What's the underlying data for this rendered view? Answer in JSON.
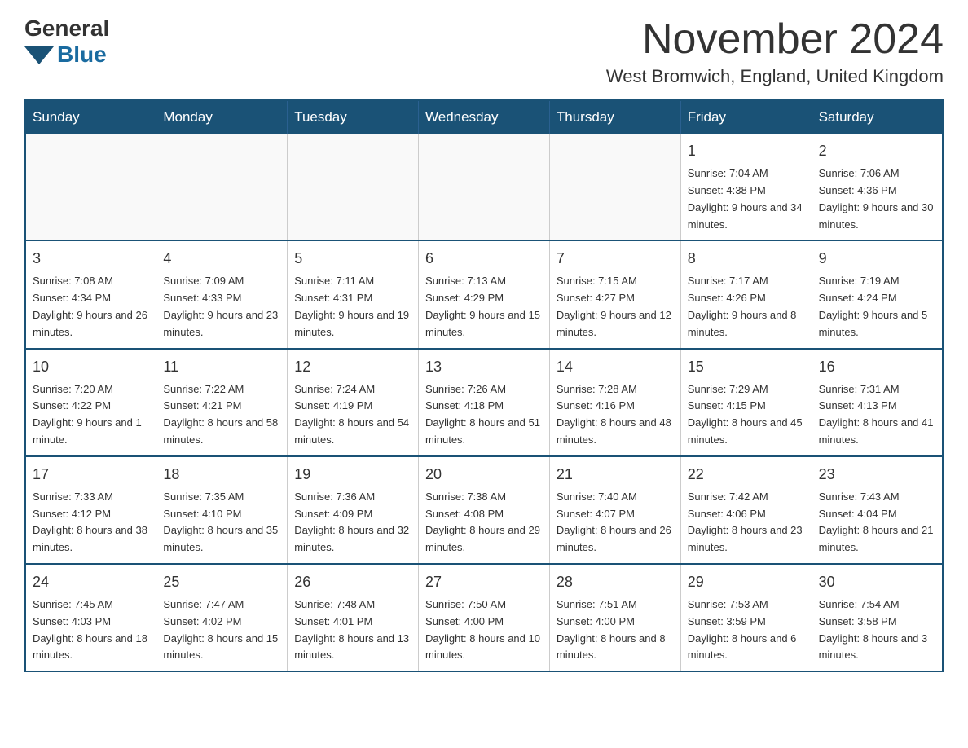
{
  "logo": {
    "general": "General",
    "blue": "Blue"
  },
  "title": "November 2024",
  "location": "West Bromwich, England, United Kingdom",
  "weekdays": [
    "Sunday",
    "Monday",
    "Tuesday",
    "Wednesday",
    "Thursday",
    "Friday",
    "Saturday"
  ],
  "weeks": [
    [
      {
        "day": "",
        "info": ""
      },
      {
        "day": "",
        "info": ""
      },
      {
        "day": "",
        "info": ""
      },
      {
        "day": "",
        "info": ""
      },
      {
        "day": "",
        "info": ""
      },
      {
        "day": "1",
        "info": "Sunrise: 7:04 AM\nSunset: 4:38 PM\nDaylight: 9 hours and 34 minutes."
      },
      {
        "day": "2",
        "info": "Sunrise: 7:06 AM\nSunset: 4:36 PM\nDaylight: 9 hours and 30 minutes."
      }
    ],
    [
      {
        "day": "3",
        "info": "Sunrise: 7:08 AM\nSunset: 4:34 PM\nDaylight: 9 hours and 26 minutes."
      },
      {
        "day": "4",
        "info": "Sunrise: 7:09 AM\nSunset: 4:33 PM\nDaylight: 9 hours and 23 minutes."
      },
      {
        "day": "5",
        "info": "Sunrise: 7:11 AM\nSunset: 4:31 PM\nDaylight: 9 hours and 19 minutes."
      },
      {
        "day": "6",
        "info": "Sunrise: 7:13 AM\nSunset: 4:29 PM\nDaylight: 9 hours and 15 minutes."
      },
      {
        "day": "7",
        "info": "Sunrise: 7:15 AM\nSunset: 4:27 PM\nDaylight: 9 hours and 12 minutes."
      },
      {
        "day": "8",
        "info": "Sunrise: 7:17 AM\nSunset: 4:26 PM\nDaylight: 9 hours and 8 minutes."
      },
      {
        "day": "9",
        "info": "Sunrise: 7:19 AM\nSunset: 4:24 PM\nDaylight: 9 hours and 5 minutes."
      }
    ],
    [
      {
        "day": "10",
        "info": "Sunrise: 7:20 AM\nSunset: 4:22 PM\nDaylight: 9 hours and 1 minute."
      },
      {
        "day": "11",
        "info": "Sunrise: 7:22 AM\nSunset: 4:21 PM\nDaylight: 8 hours and 58 minutes."
      },
      {
        "day": "12",
        "info": "Sunrise: 7:24 AM\nSunset: 4:19 PM\nDaylight: 8 hours and 54 minutes."
      },
      {
        "day": "13",
        "info": "Sunrise: 7:26 AM\nSunset: 4:18 PM\nDaylight: 8 hours and 51 minutes."
      },
      {
        "day": "14",
        "info": "Sunrise: 7:28 AM\nSunset: 4:16 PM\nDaylight: 8 hours and 48 minutes."
      },
      {
        "day": "15",
        "info": "Sunrise: 7:29 AM\nSunset: 4:15 PM\nDaylight: 8 hours and 45 minutes."
      },
      {
        "day": "16",
        "info": "Sunrise: 7:31 AM\nSunset: 4:13 PM\nDaylight: 8 hours and 41 minutes."
      }
    ],
    [
      {
        "day": "17",
        "info": "Sunrise: 7:33 AM\nSunset: 4:12 PM\nDaylight: 8 hours and 38 minutes."
      },
      {
        "day": "18",
        "info": "Sunrise: 7:35 AM\nSunset: 4:10 PM\nDaylight: 8 hours and 35 minutes."
      },
      {
        "day": "19",
        "info": "Sunrise: 7:36 AM\nSunset: 4:09 PM\nDaylight: 8 hours and 32 minutes."
      },
      {
        "day": "20",
        "info": "Sunrise: 7:38 AM\nSunset: 4:08 PM\nDaylight: 8 hours and 29 minutes."
      },
      {
        "day": "21",
        "info": "Sunrise: 7:40 AM\nSunset: 4:07 PM\nDaylight: 8 hours and 26 minutes."
      },
      {
        "day": "22",
        "info": "Sunrise: 7:42 AM\nSunset: 4:06 PM\nDaylight: 8 hours and 23 minutes."
      },
      {
        "day": "23",
        "info": "Sunrise: 7:43 AM\nSunset: 4:04 PM\nDaylight: 8 hours and 21 minutes."
      }
    ],
    [
      {
        "day": "24",
        "info": "Sunrise: 7:45 AM\nSunset: 4:03 PM\nDaylight: 8 hours and 18 minutes."
      },
      {
        "day": "25",
        "info": "Sunrise: 7:47 AM\nSunset: 4:02 PM\nDaylight: 8 hours and 15 minutes."
      },
      {
        "day": "26",
        "info": "Sunrise: 7:48 AM\nSunset: 4:01 PM\nDaylight: 8 hours and 13 minutes."
      },
      {
        "day": "27",
        "info": "Sunrise: 7:50 AM\nSunset: 4:00 PM\nDaylight: 8 hours and 10 minutes."
      },
      {
        "day": "28",
        "info": "Sunrise: 7:51 AM\nSunset: 4:00 PM\nDaylight: 8 hours and 8 minutes."
      },
      {
        "day": "29",
        "info": "Sunrise: 7:53 AM\nSunset: 3:59 PM\nDaylight: 8 hours and 6 minutes."
      },
      {
        "day": "30",
        "info": "Sunrise: 7:54 AM\nSunset: 3:58 PM\nDaylight: 8 hours and 3 minutes."
      }
    ]
  ]
}
